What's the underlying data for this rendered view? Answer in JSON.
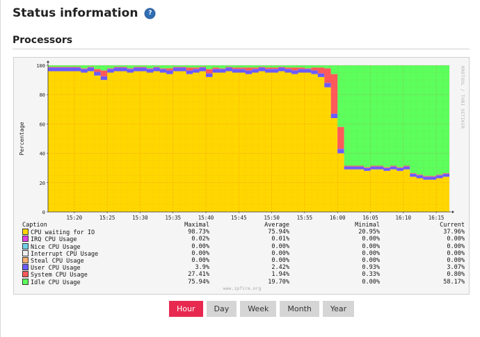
{
  "page": {
    "title": "Status information",
    "help_icon": "?"
  },
  "section": {
    "title": "Processors"
  },
  "graph": {
    "vertical_credit": "RRDTOOL / TOBI OETIKER",
    "watermark": "www.ipfire.org",
    "colors": {
      "io": "#ffd700",
      "irq": "#e040e0",
      "nice": "#6fd0e8",
      "interrupt": "#f0f0f0",
      "steal": "#ffb070",
      "user": "#6a5cff",
      "system": "#ff5a5a",
      "idle": "#5cff5c"
    }
  },
  "chart_data": {
    "type": "area",
    "ylabel": "Percentage",
    "ylim": [
      0,
      100
    ],
    "yticks": [
      "0",
      "20",
      "40",
      "60",
      "80",
      "100"
    ],
    "xticks": [
      "15:20",
      "15:25",
      "15:30",
      "15:35",
      "15:40",
      "15:45",
      "15:50",
      "15:55",
      "16:00",
      "16:05",
      "16:10",
      "16:15"
    ],
    "x": [
      "15:16",
      "15:17",
      "15:18",
      "15:19",
      "15:20",
      "15:21",
      "15:22",
      "15:23",
      "15:24",
      "15:25",
      "15:26",
      "15:27",
      "15:28",
      "15:29",
      "15:30",
      "15:31",
      "15:32",
      "15:33",
      "15:34",
      "15:35",
      "15:36",
      "15:37",
      "15:38",
      "15:39",
      "15:40",
      "15:41",
      "15:42",
      "15:43",
      "15:44",
      "15:45",
      "15:46",
      "15:47",
      "15:48",
      "15:49",
      "15:50",
      "15:51",
      "15:52",
      "15:53",
      "15:54",
      "15:55",
      "15:56",
      "15:57",
      "15:58",
      "15:59",
      "16:00",
      "16:01",
      "16:02",
      "16:03",
      "16:04",
      "16:05",
      "16:06",
      "16:07",
      "16:08",
      "16:09",
      "16:10",
      "16:11",
      "16:12",
      "16:13",
      "16:14",
      "16:15",
      "16:16"
    ],
    "stack_order": [
      "CPU waiting for IO",
      "User CPU Usage",
      "System CPU Usage",
      "Idle CPU Usage"
    ],
    "series": [
      {
        "name": "CPU waiting for IO",
        "values": [
          96,
          96,
          96,
          96,
          96,
          95,
          96,
          93,
          90,
          95,
          96,
          96,
          95,
          96,
          96,
          95,
          96,
          95,
          94,
          96,
          96,
          94,
          95,
          96,
          92,
          95,
          95,
          96,
          95,
          95,
          94,
          95,
          96,
          95,
          95,
          96,
          95,
          94,
          95,
          95,
          94,
          92,
          85,
          64,
          40,
          29,
          29,
          29,
          28,
          29,
          29,
          28,
          29,
          28,
          29,
          24,
          23,
          22,
          22,
          23,
          24
        ]
      },
      {
        "name": "User CPU Usage",
        "values": [
          2.5,
          2.5,
          2.5,
          2.5,
          2.5,
          2.5,
          2.5,
          2.5,
          2.5,
          2.5,
          2.5,
          2.5,
          2.5,
          2.5,
          2.5,
          2.5,
          2.5,
          2.5,
          2.5,
          2.5,
          2.5,
          2.5,
          2.5,
          2.5,
          2.5,
          2.5,
          2.5,
          2.5,
          2.5,
          2.5,
          2.5,
          2.5,
          2.5,
          2.5,
          2.5,
          2.5,
          2.5,
          2.5,
          2.5,
          2.5,
          2.5,
          2.5,
          3,
          3,
          3,
          2,
          2,
          2,
          2,
          2,
          2,
          2,
          2,
          2,
          2,
          2,
          2,
          2,
          2,
          2,
          2
        ]
      },
      {
        "name": "System CPU Usage",
        "values": [
          0.5,
          0.5,
          0.5,
          0.5,
          0.5,
          0.5,
          0.5,
          2,
          4,
          0.5,
          0.5,
          0.5,
          0.5,
          0.5,
          0.5,
          0.5,
          0.5,
          0.5,
          1.5,
          0.5,
          0.5,
          2,
          1,
          0.5,
          3,
          1,
          0.5,
          0.5,
          1,
          1,
          2,
          1,
          0.5,
          1,
          1,
          0.5,
          1,
          2,
          1,
          0.5,
          2,
          4,
          10,
          27,
          15,
          0.5,
          0.5,
          0.5,
          0.5,
          0.5,
          0.5,
          0.5,
          0.5,
          0.5,
          0.5,
          0.5,
          0.5,
          0.5,
          0.5,
          0.5,
          0.5
        ]
      },
      {
        "name": "Idle CPU Usage",
        "values": [
          1,
          1,
          1,
          1,
          1,
          2,
          1,
          2.5,
          3.5,
          2,
          1,
          1,
          2,
          1,
          1,
          2,
          1,
          2,
          2,
          1,
          1,
          1.5,
          1.5,
          1,
          2.5,
          1.5,
          2,
          1,
          1.5,
          1.5,
          1.5,
          1.5,
          1,
          1.5,
          1.5,
          1,
          1.5,
          1.5,
          1.5,
          2,
          1.5,
          1.5,
          2,
          6,
          42,
          68.5,
          68.5,
          68.5,
          69.5,
          68.5,
          68.5,
          69.5,
          68.5,
          69.5,
          68.5,
          73.5,
          74.5,
          75.5,
          75.5,
          74.5,
          73.5
        ]
      }
    ],
    "legend": {
      "headers": [
        "Caption",
        "Maximal",
        "Average",
        "Minimal",
        "Current"
      ],
      "rows": [
        {
          "key": "io",
          "caption": "CPU waiting for IO",
          "max": "98.73%",
          "avg": "75.94%",
          "min": "20.95%",
          "cur": "37.96%"
        },
        {
          "key": "irq",
          "caption": "IRQ CPU Usage",
          "max": "0.02%",
          "avg": "0.01%",
          "min": "0.00%",
          "cur": "0.00%"
        },
        {
          "key": "nice",
          "caption": "Nice CPU Usage",
          "max": "0.00%",
          "avg": "0.00%",
          "min": "0.00%",
          "cur": "0.00%"
        },
        {
          "key": "interrupt",
          "caption": "Interrupt CPU Usage",
          "max": "0.00%",
          "avg": "0.00%",
          "min": "0.00%",
          "cur": "0.00%"
        },
        {
          "key": "steal",
          "caption": "Steal CPU Usage",
          "max": "0.00%",
          "avg": "0.00%",
          "min": "0.00%",
          "cur": "0.00%"
        },
        {
          "key": "user",
          "caption": "User CPU Usage",
          "max": "3.9%",
          "avg": "2.42%",
          "min": "0.93%",
          "cur": "3.07%"
        },
        {
          "key": "system",
          "caption": "System CPU Usage",
          "max": "27.41%",
          "avg": "1.94%",
          "min": "0.33%",
          "cur": "0.80%"
        },
        {
          "key": "idle",
          "caption": "Idle CPU Usage",
          "max": "75.94%",
          "avg": "19.70%",
          "min": "0.00%",
          "cur": "58.17%"
        }
      ]
    }
  },
  "periods": [
    {
      "label": "Hour",
      "active": true
    },
    {
      "label": "Day",
      "active": false
    },
    {
      "label": "Week",
      "active": false
    },
    {
      "label": "Month",
      "active": false
    },
    {
      "label": "Year",
      "active": false
    }
  ]
}
